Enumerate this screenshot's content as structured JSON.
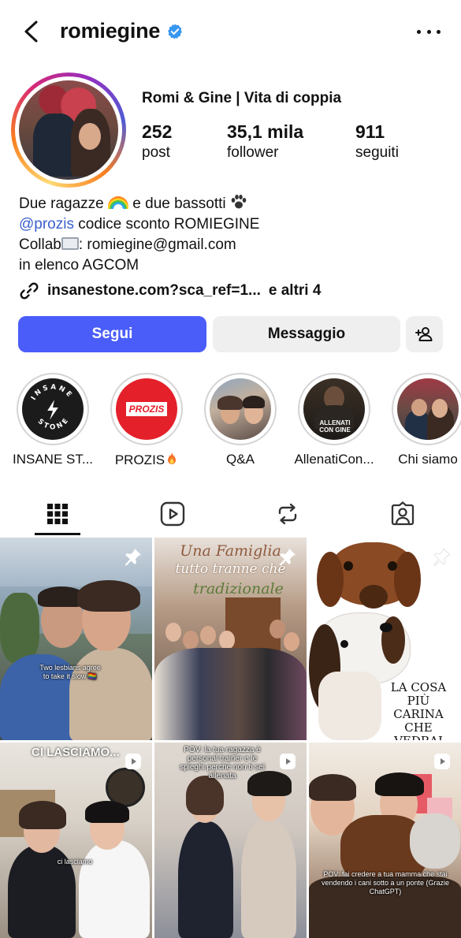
{
  "header": {
    "username": "romiegine",
    "verified": true,
    "icons": [
      "back-icon",
      "verified-badge-icon",
      "more-icon"
    ]
  },
  "profile": {
    "full_name": "Romi & Gine | Vita di coppia",
    "stats": {
      "posts_num": "252",
      "posts_label": "post",
      "followers_num": "35,1 mila",
      "followers_label": "follower",
      "following_num": "911",
      "following_label": "seguiti"
    },
    "bio": {
      "line1_a": "Due ragazze ",
      "line1_b": " e due bassotti ",
      "mention": "@prozis",
      "line2_rest": " codice sconto ROMIEGINE",
      "line3_a": "Collab",
      "line3_b": ": romiegine@gmail.com",
      "line4": "in elenco AGCOM"
    },
    "link": {
      "url": "insanestone.com?sca_ref=1...",
      "more": "e altri 4"
    }
  },
  "buttons": {
    "follow": "Segui",
    "message": "Messaggio"
  },
  "highlights": [
    {
      "label": "INSANE ST...",
      "cover_text": "INSANE STONE"
    },
    {
      "label": "PROZIS",
      "cover_text": "PROZIS"
    },
    {
      "label": "Q&A"
    },
    {
      "label": "AllenatiCon...",
      "cover_text": "ALLENATI CON GINE"
    },
    {
      "label": "Chi siamo"
    }
  ],
  "tabs": [
    "grid-icon",
    "reels-icon",
    "reposts-icon",
    "tagged-icon"
  ],
  "posts": [
    {
      "caption": "Two lesbians agree to take it slow 🏳️‍🌈",
      "pinned": true
    },
    {
      "title1": "Una Famiglia",
      "title2": "tutto tranne che",
      "title3": "tradizionale",
      "pinned": true
    },
    {
      "text": "LA COSA PIÙ CARINA CHE VEDRAI OGGI",
      "pinned": true
    },
    {
      "title": "CI LASCIAMO...",
      "caption": "ci lasciamo",
      "reel": true
    },
    {
      "caption": "POV: la tua ragazza è personal trainer e le spieghi perchè non ti sei allenata",
      "reel": true
    },
    {
      "caption": "POV: fai credere a tua mamma che stai vendendo i cani sotto a un ponte (Grazie ChatGPT)",
      "reel": true
    }
  ],
  "colors": {
    "follow_button": "#4a5df9",
    "mention": "#3a5fcd",
    "verified": "#3897f0",
    "neutral_button": "#efefef"
  }
}
